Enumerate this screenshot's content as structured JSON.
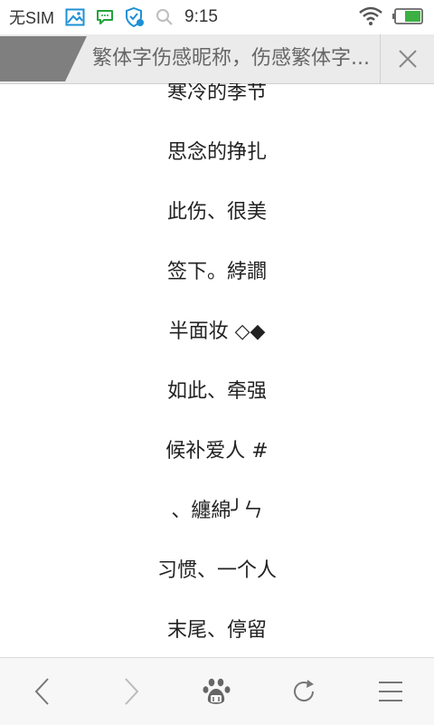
{
  "status_bar": {
    "carrier": "无SIM",
    "time": "9:15",
    "icons": [
      "image-icon",
      "message-icon",
      "shield-icon",
      "search-icon",
      "wifi-icon",
      "battery-icon"
    ]
  },
  "title_bar": {
    "title": "繁体字伤感昵称，伤感繁体字...",
    "close_icon": "close-icon"
  },
  "nicknames": [
    "寒冷的季节",
    "思念的挣扎",
    "此伤、很美",
    "签下。綍讇",
    "半面妆 ◇◆",
    "如此、牵强",
    "候补爱人 #",
    "、纏綿╯ㄣ",
    "习惯、一个人",
    "末尾、停留"
  ],
  "toolbar": {
    "items": [
      "back-icon",
      "forward-icon",
      "baidu-paw-icon",
      "refresh-icon",
      "menu-icon"
    ]
  },
  "colors": {
    "tab_accent": "#7f7f7f",
    "title_bg": "#ebebeb",
    "icon_blue": "#1e90d6",
    "icon_green": "#22a33a"
  }
}
